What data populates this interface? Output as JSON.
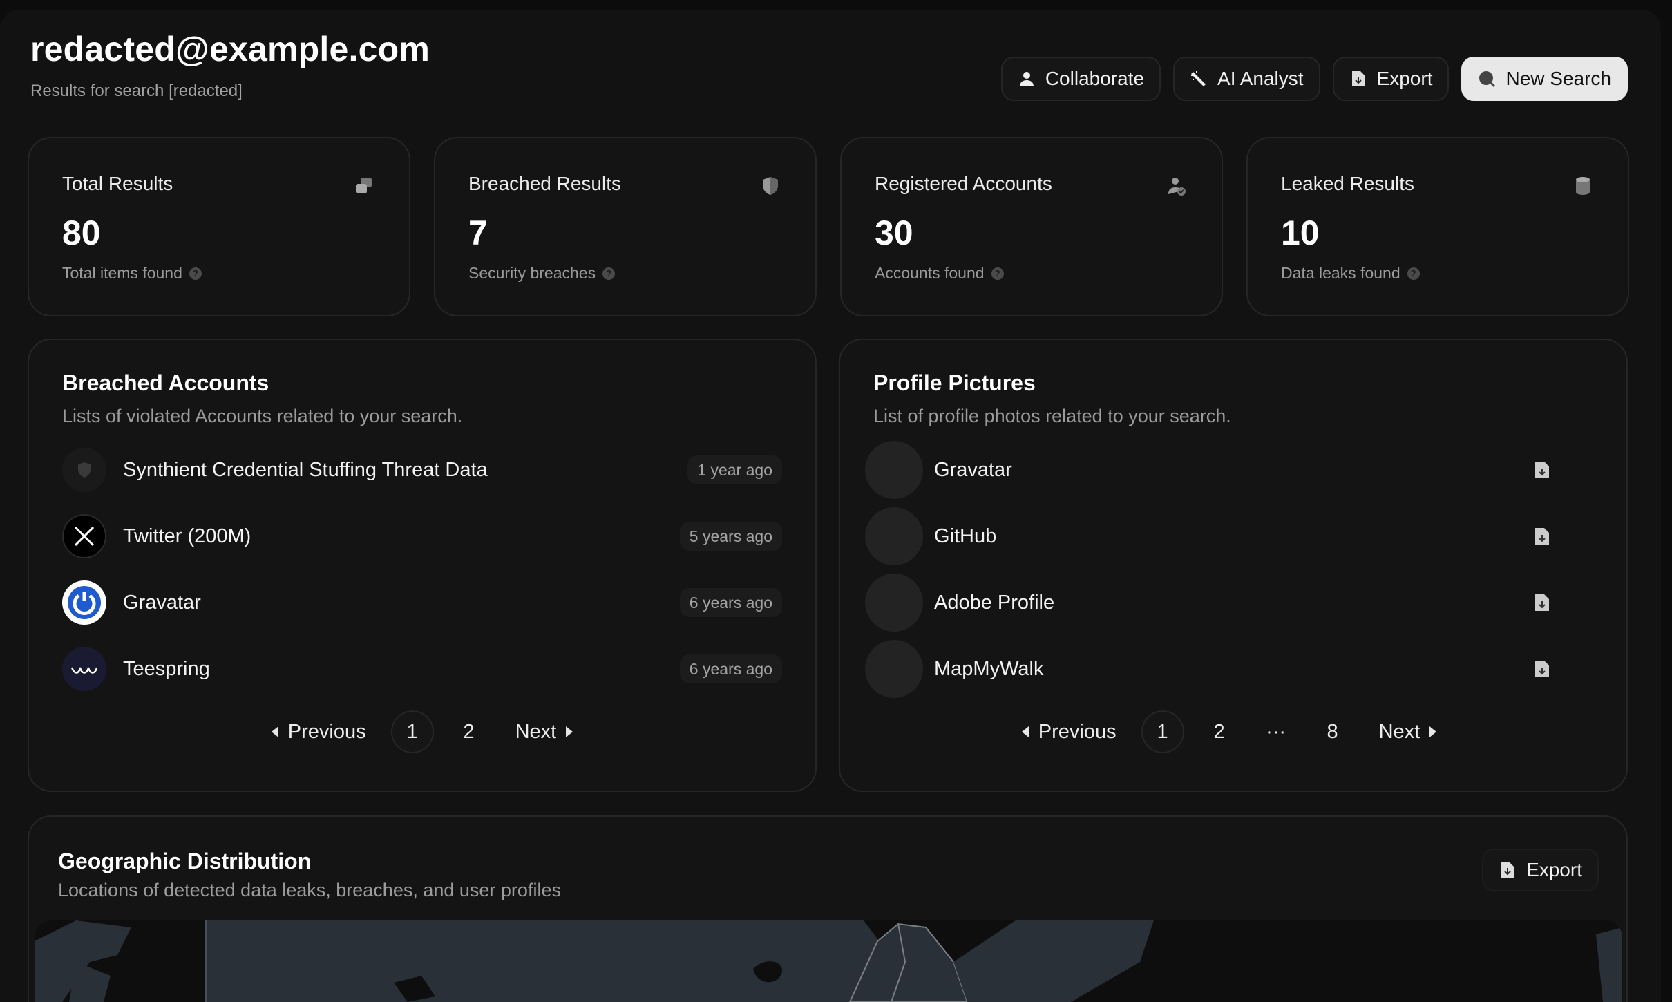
{
  "header": {
    "title": "redacted@example.com",
    "subtitle": "Results for search [redacted]",
    "actions": [
      {
        "label": "Collaborate",
        "icon": "user-icon"
      },
      {
        "label": "AI Analyst",
        "icon": "wand-icon"
      },
      {
        "label": "Export",
        "icon": "file-download-icon"
      },
      {
        "label": "New Search",
        "icon": "search-icon"
      }
    ]
  },
  "stats": [
    {
      "label": "Total Results",
      "value": "80",
      "sub": "Total items found",
      "icon": "copy-icon"
    },
    {
      "label": "Breached Results",
      "value": "7",
      "sub": "Security breaches",
      "icon": "shield-icon"
    },
    {
      "label": "Registered Accounts",
      "value": "30",
      "sub": "Accounts found",
      "icon": "user-check-icon"
    },
    {
      "label": "Leaked Results",
      "value": "10",
      "sub": "Data leaks found",
      "icon": "database-icon"
    }
  ],
  "breached": {
    "title": "Breached Accounts",
    "description": "Lists of violated Accounts related to your search.",
    "items": [
      {
        "name": "Synthient Credential Stuffing Threat Data",
        "time": "1 year ago",
        "logo": "shield-logo-icon"
      },
      {
        "name": "Twitter (200M)",
        "time": "5 years ago",
        "logo": "x-logo-icon"
      },
      {
        "name": "Gravatar",
        "time": "6 years ago",
        "logo": "gravatar-logo-icon"
      },
      {
        "name": "Teespring",
        "time": "6 years ago",
        "logo": "teespring-logo-icon"
      }
    ],
    "pager": {
      "previous": "Previous",
      "pages": [
        "1",
        "2"
      ],
      "next": "Next",
      "current": "1"
    }
  },
  "profiles": {
    "title": "Profile Pictures",
    "description": "List of profile photos related to your search.",
    "items": [
      {
        "name": "Gravatar"
      },
      {
        "name": "GitHub"
      },
      {
        "name": "Adobe Profile"
      },
      {
        "name": "MapMyWalk"
      }
    ],
    "pager": {
      "previous": "Previous",
      "pages": [
        "1",
        "2",
        "···",
        "8"
      ],
      "next": "Next",
      "current": "1"
    }
  },
  "geo": {
    "title": "Geographic Distribution",
    "description": "Locations of detected data leaks, breaches, and user profiles",
    "export": "Export"
  },
  "colors": {
    "background": "#121212",
    "card": "#141414",
    "border": "#262626",
    "primary_button": "#e8e8e8",
    "map_land": "#2a3038",
    "gravatar_blue": "#1e5bd0"
  }
}
